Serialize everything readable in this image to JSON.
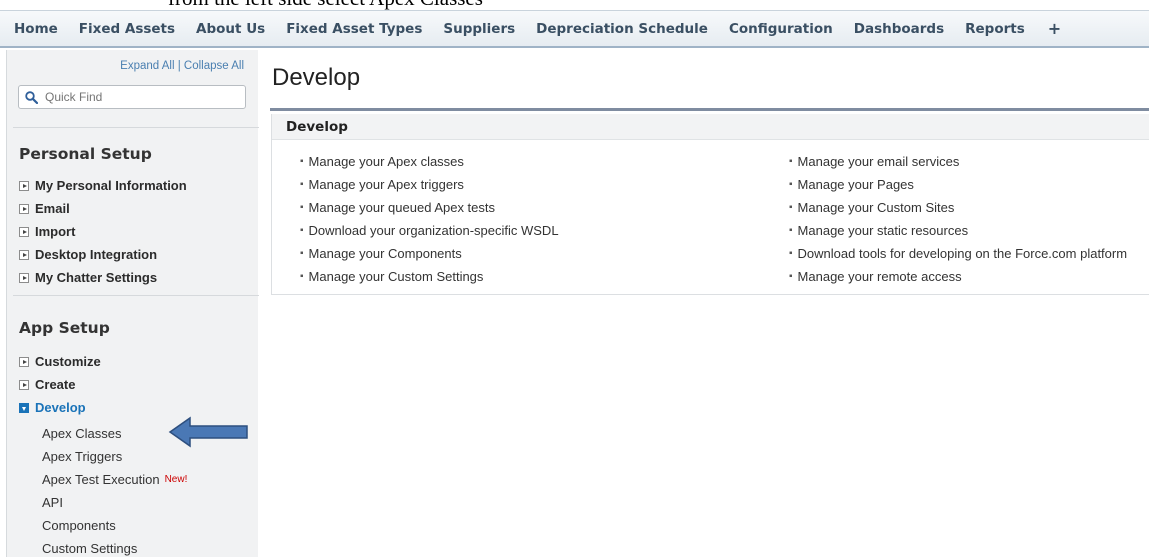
{
  "caption": "from the left side select Apex Classes",
  "tabs": [
    "Home",
    "Fixed Assets",
    "About Us",
    "Fixed Asset Types",
    "Suppliers",
    "Depreciation Schedule",
    "Configuration",
    "Dashboards",
    "Reports",
    "+"
  ],
  "sidebar": {
    "expand_all": "Expand All",
    "divider": " | ",
    "collapse_all": "Collapse All",
    "search_placeholder": "Quick Find",
    "personal_setup": {
      "title": "Personal Setup",
      "items": [
        "My Personal Information",
        "Email",
        "Import",
        "Desktop Integration",
        "My Chatter Settings"
      ]
    },
    "app_setup": {
      "title": "App Setup",
      "items": [
        "Customize",
        "Create",
        "Develop"
      ],
      "develop_children": [
        "Apex Classes",
        "Apex Triggers",
        "Apex Test Execution",
        "API",
        "Components",
        "Custom Settings"
      ],
      "new_badge": "New!"
    }
  },
  "main": {
    "page_title": "Develop",
    "panel_title": "Develop",
    "left_links": [
      "Manage your Apex classes",
      "Manage your Apex triggers",
      "Manage your queued Apex tests",
      "Download your organization-specific WSDL",
      "Manage your Components",
      "Manage your Custom Settings"
    ],
    "right_links": [
      "Manage your email services",
      "Manage your Pages",
      "Manage your Custom Sites",
      "Manage your static resources",
      "Download tools for developing on the Force.com platform",
      "Manage your remote access"
    ]
  },
  "colors": {
    "tab_text": "#3a4f63",
    "develop_active": "#1a73b8",
    "arrow": "#4a78b5",
    "new_badge": "#cc0000"
  },
  "icons": {
    "search": "search-icon",
    "arrow": "left-arrow-annotation"
  }
}
